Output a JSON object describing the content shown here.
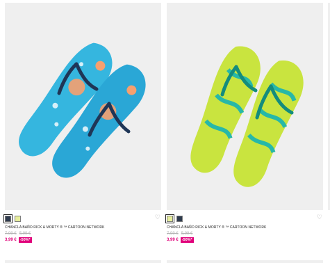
{
  "products": [
    {
      "name": "CHANCLA BAÑO RICK & MORTY ® ™ CARTOON NETWORK",
      "old_price": "7,99 €",
      "mid_price": "5,99 €",
      "price": "3,99 €",
      "discount": "-50%*",
      "swatches": [
        "#2f3b4e",
        "#e7ee9c"
      ],
      "favorite_icon": "heart-outline-icon"
    },
    {
      "name": "CHANCLA BAÑO RICK & MORTY ® ™ CARTOON NETWORK",
      "old_price": "7,99 €",
      "mid_price": "5,99 €",
      "price": "3,99 €",
      "discount": "-50%*",
      "swatches": [
        "#e7ee9c",
        "#2f3b4e"
      ],
      "favorite_icon": "heart-outline-icon"
    }
  ],
  "colors": {
    "sale_pink": "#e0007a",
    "image_bg": "#efefef"
  }
}
